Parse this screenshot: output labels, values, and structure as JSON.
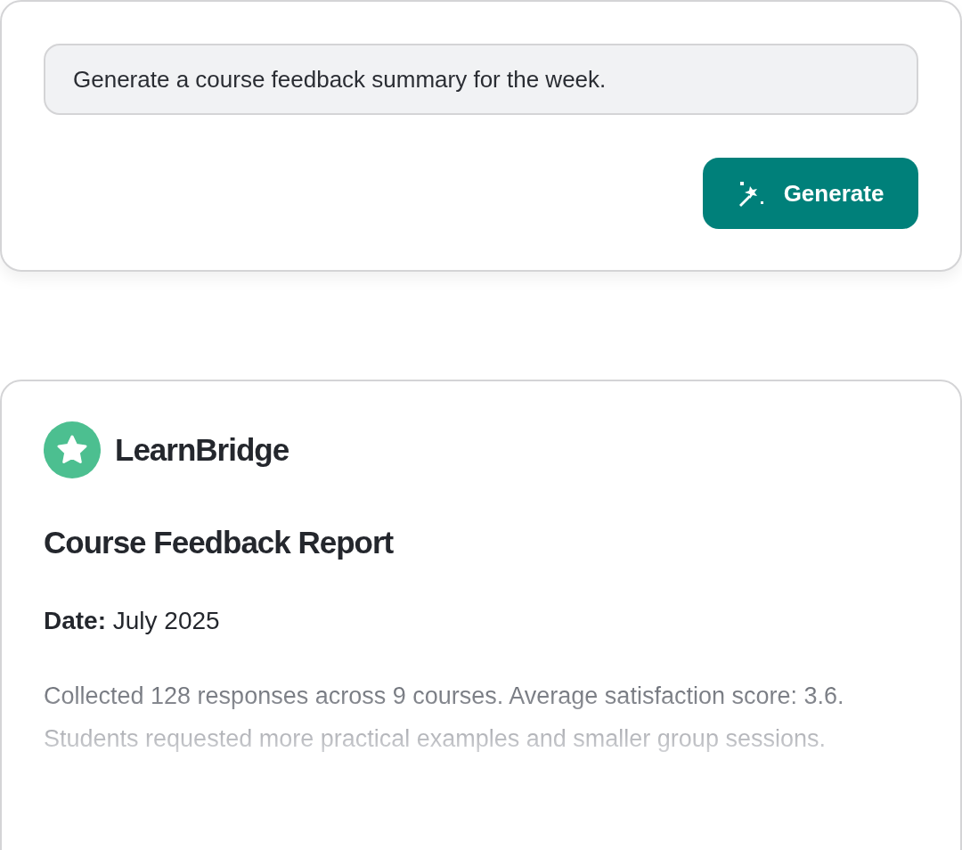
{
  "prompt": {
    "value": "Generate a course feedback summary for the week."
  },
  "generate_button": {
    "label": "Generate"
  },
  "report": {
    "brand": "LearnBridge",
    "title": "Course Feedback Report",
    "date": "**Date:** July 2025",
    "summary": "Collected 128 responses across 9 courses. Average satisfaction score: 3.6. Students requested more practical examples and smaller group sessions."
  }
}
